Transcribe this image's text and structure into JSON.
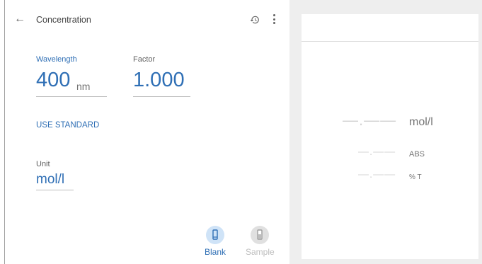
{
  "header": {
    "title": "Concentration"
  },
  "wavelength": {
    "label": "Wavelength",
    "value": "400",
    "unit": "nm"
  },
  "factor": {
    "label": "Factor",
    "value": "1.000"
  },
  "use_standard": "USE STANDARD",
  "unit_field": {
    "label": "Unit",
    "value": "mol/l"
  },
  "buttons": {
    "blank": "Blank",
    "sample": "Sample"
  },
  "readout": {
    "concentration": {
      "value": "—.——",
      "unit": "mol/l"
    },
    "abs": {
      "value": "—.——",
      "unit": "ABS"
    },
    "transmittance": {
      "value": "—.——",
      "unit": "% T"
    }
  },
  "colors": {
    "accent": "#2f6fb5",
    "blank_bg": "#cfe3f7",
    "sample_bg": "#e0e0e0"
  }
}
